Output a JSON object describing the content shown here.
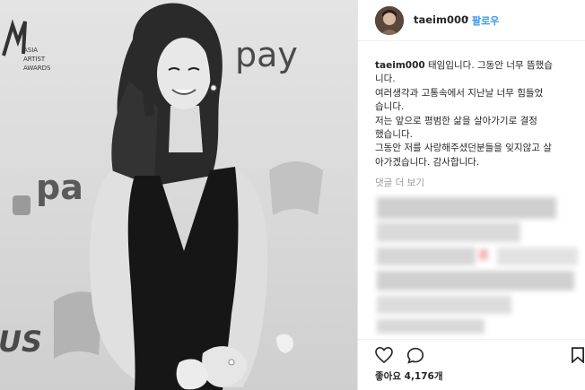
{
  "post": {
    "username": "taeim000",
    "dot": "•",
    "follow_label": "팔로우",
    "caption_user": "taeim000",
    "caption_text": " 태임입니다. 그동안 너무 뜸했습\n니다.\n여러생각과 고통속에서 지난날 너무 힘들었\n습니다.\n저는 앞으로 평범한 삶을 살아가기로 결정\n했습니다.\n그동안 저를 사랑해주셨던분들을 잊지않고 살\n아가겠습니다. 감사합니다.",
    "view_comments_label": "댓글 더 보기",
    "likes_label": "좋아요 4,176개"
  },
  "photo": {
    "backdrop_texts": [
      "pay",
      "pa",
      "US",
      "ASIA",
      "ARTIST",
      "AWARDS"
    ]
  },
  "icons": {
    "like": "heart-icon",
    "comment": "comment-icon",
    "save": "bookmark-icon"
  },
  "colors": {
    "follow": "#3897f0",
    "text": "#262626",
    "muted": "#999999"
  }
}
